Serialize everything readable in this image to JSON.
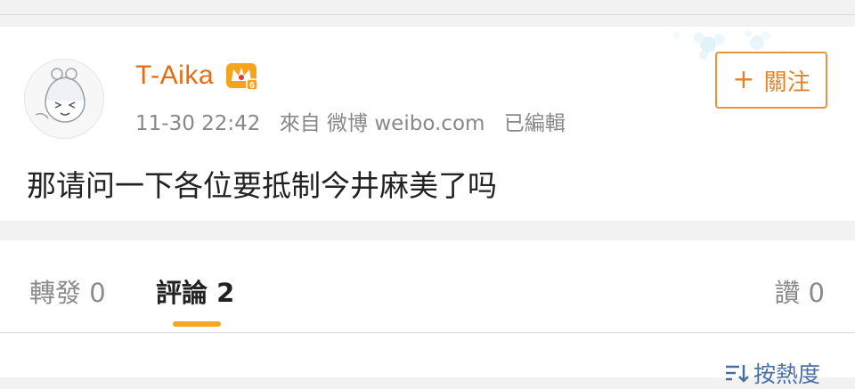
{
  "post": {
    "username": "T-Aika",
    "timestamp": "11-30 22:42",
    "source": "來自 微博 weibo.com",
    "edited": "已編輯",
    "follow_label": "關注",
    "text": "那请问一下各位要抵制今井麻美了吗",
    "badge_icon": "crown-vip-icon",
    "badge_level": "6"
  },
  "tabs": {
    "repost": "轉發 0",
    "comment": "評論 2",
    "like": "讚 0"
  },
  "sort": {
    "label": "按熱度",
    "icon": "sort-icon"
  },
  "colors": {
    "username": "#e86b11",
    "follow_border": "#e8953e",
    "tab_underline": "#f5a623",
    "sort_text": "#4a6fa5"
  }
}
